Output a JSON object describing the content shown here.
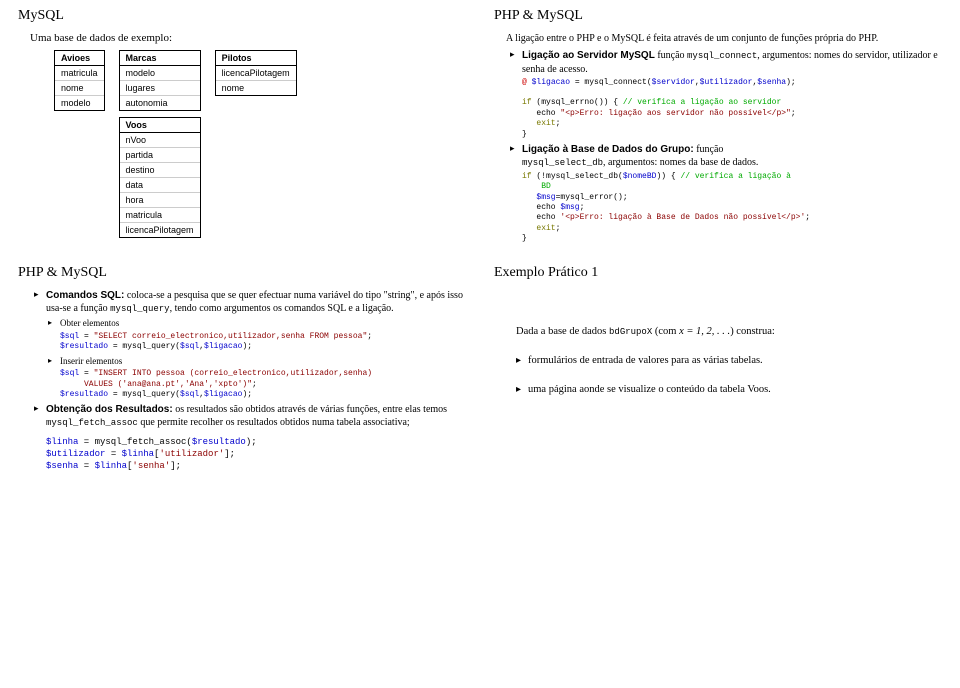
{
  "slide1": {
    "title": "MySQL",
    "subtitle": "Uma base de dados de exemplo:",
    "tables": {
      "avioes": {
        "name": "Avioes",
        "cols": [
          "matricula",
          "nome",
          "modelo"
        ]
      },
      "marcas": {
        "name": "Marcas",
        "cols": [
          "modelo",
          "lugares",
          "autonomia"
        ]
      },
      "voos": {
        "name": "Voos",
        "cols": [
          "nVoo",
          "partida",
          "destino",
          "data",
          "hora",
          "matricula",
          "licencaPilotagem"
        ]
      },
      "pilotos": {
        "name": "Pilotos",
        "cols": [
          "licencaPilotagem",
          "nome"
        ]
      }
    }
  },
  "slide2": {
    "title": "PHP & MySQL",
    "intro": "A ligação entre o PHP e o MySQL é feita através de um conjunto de funções própria do PHP.",
    "b1_bold": "Ligação ao Servidor MySQL",
    "b1_rest_a": " função ",
    "b1_rest_b": "mysql_connect",
    "b1_rest_c": ", argumentos: nomes do servidor, utilizador e senha de acesso.",
    "code1_l1a": "@ ",
    "code1_l1b": "$ligacao",
    "code1_l1c": " = mysql_connect(",
    "code1_l1d": "$servidor",
    "code1_l1e": ",",
    "code1_l1f": "$utilizador",
    "code1_l1g": ",",
    "code1_l1h": "$senha",
    "code1_l1i": ");",
    "code1_l2a": "if",
    "code1_l2b": " (mysql_errno()) { ",
    "code1_l2c": "// verifica a ligação ao servidor",
    "code1_l3a": "   echo ",
    "code1_l3b": "\"<p>Erro: ligação aos servidor não possível</p>\"",
    "code1_l3c": ";",
    "code1_l4a": "   exit",
    "code1_l4b": ";",
    "code1_l5": "}",
    "b2_bold": "Ligação à Base de Dados do Grupo:",
    "b2_rest_a": " função ",
    "b2_rest_b": "mysql_select_db",
    "b2_rest_c": ", argumentos: nomes da base de dados.",
    "code2_l1a": "if",
    "code2_l1b": " (!mysql_select_db(",
    "code2_l1c": "$nomeBD",
    "code2_l1d": ")) { ",
    "code2_l1e": "// verifica a ligação à",
    "code2_l1f": "    BD",
    "code2_l2a": "   ",
    "code2_l2b": "$msg",
    "code2_l2c": "=mysql_error();",
    "code2_l3a": "   echo ",
    "code2_l3b": "$msg",
    "code2_l3c": ";",
    "code2_l4a": "   echo ",
    "code2_l4b": "'<p>Erro: ligação à Base de Dados não possível</p>'",
    "code2_l4c": ";",
    "code2_l5a": "   exit",
    "code2_l5b": ";",
    "code2_l6": "}"
  },
  "slide3": {
    "title": "PHP & MySQL",
    "b1_bold": "Comandos SQL:",
    "b1_rest": " coloca-se a pesquisa que se quer efectuar numa variável do tipo \"string\", e após isso usa-se a função ",
    "b1_tt": "mysql_query",
    "b1_rest2": ", tendo como argumentos os comandos SQL e a ligação.",
    "b1a": "Obter elementos",
    "c1_l1a": "$sql",
    "c1_l1b": " = ",
    "c1_l1c": "\"SELECT correio_electronico,utilizador,senha FROM pessoa\"",
    "c1_l1d": ";",
    "c1_l2a": "$resultado",
    "c1_l2b": " = mysql_query(",
    "c1_l2c": "$sql",
    "c1_l2d": ",",
    "c1_l2e": "$ligacao",
    "c1_l2f": ");",
    "b1b": "Inserir elementos",
    "c2_l1a": "$sql",
    "c2_l1b": " = ",
    "c2_l1c": "\"INSERT INTO pessoa (correio_electronico,utilizador,senha)",
    "c2_l1d": "     VALUES ('ana@ana.pt','Ana','xpto')\"",
    "c2_l1e": ";",
    "c2_l2a": "$resultado",
    "c2_l2b": " = mysql_query(",
    "c2_l2c": "$sql",
    "c2_l2d": ",",
    "c2_l2e": "$ligacao",
    "c2_l2f": ");",
    "b2_bold": "Obtenção dos Resultados:",
    "b2_rest": " os resultados são obtidos através de várias funções, entre elas temos ",
    "b2_tt": "mysql_fetch_assoc",
    "b2_rest2": " que permite recolher os resultados obtidos numa tabela associativa;",
    "cb_l1a": "$linha",
    "cb_l1b": " = mysql_fetch_assoc(",
    "cb_l1c": "$resultado",
    "cb_l1d": ");",
    "cb_l2a": "$utilizador",
    "cb_l2b": " = ",
    "cb_l2c": "$linha",
    "cb_l2d": "[",
    "cb_l2e": "'utilizador'",
    "cb_l2f": "];",
    "cb_l3a": "$senha",
    "cb_l3b": " = ",
    "cb_l3c": "$linha",
    "cb_l3d": "[",
    "cb_l3e": "'senha'",
    "cb_l3f": "];"
  },
  "slide4": {
    "title": "Exemplo Prático 1",
    "intro_a": "Dada a base de dados ",
    "intro_b": "bdGrupoX",
    "intro_c": " (com ",
    "intro_d": "x = 1, 2, . . .",
    "intro_e": ") construa:",
    "b1": "formulários de entrada de valores para as várias tabelas.",
    "b2": "uma página aonde se visualize o conteúdo da tabela Voos."
  }
}
